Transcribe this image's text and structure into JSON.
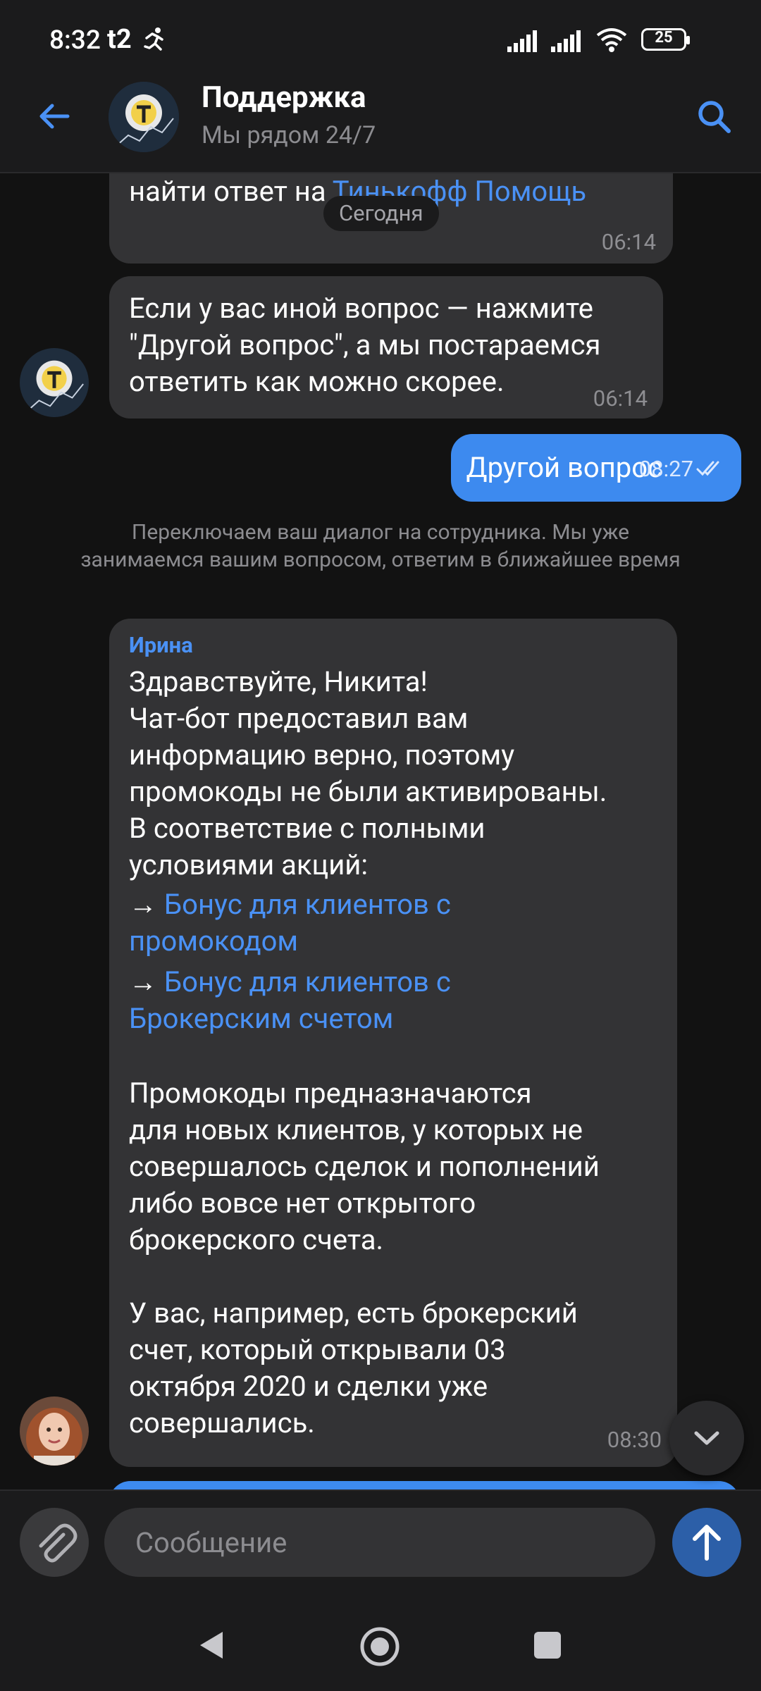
{
  "status_bar": {
    "time": "8:32",
    "carrier": "t2",
    "battery": "25"
  },
  "header": {
    "title": "Поддержка",
    "subtitle": "Мы рядом 24/7"
  },
  "chat": {
    "date_pill": "Сегодня",
    "msg1": {
      "partial_text": "найти ответ на ",
      "link": "Тинькофф Помощь",
      "time": "06:14"
    },
    "msg2": {
      "lines": [
        "Если у вас иной вопрос — нажмите",
        "\"Другой вопрос\", а мы постараемся",
        "ответить как можно скорее."
      ],
      "time": "06:14"
    },
    "outgoing": {
      "text": "Другой вопрос",
      "time": "08:27"
    },
    "system": "Переключаем ваш диалог на сотрудника. Мы уже занимаемся вашим вопросом, ответим в ближайшее время",
    "operator": {
      "author": "Ирина",
      "p1": [
        "Здравствуйте, Никита!",
        "Чат-бот предоставил вам",
        "информацию верно, поэтому",
        "промокоды не были активированы.",
        "В соответствие с полными",
        "условиями акций:"
      ],
      "arrow": "→",
      "link1_lines": [
        "Бонус для клиентов с",
        "промокодом"
      ],
      "link2_lines": [
        "Бонус для клиентов с",
        "Брокерским счетом"
      ],
      "p2": [
        "Промокоды предназначаются",
        "для новых клиентов, у которых не",
        "совершалось сделок и пополнений",
        "либо вовсе нет открытого",
        "брокерского счета."
      ],
      "p3": [
        "У вас, например, есть брокерский",
        "счет, который открывали 03",
        "октября 2020 и сделки уже",
        "совершались."
      ],
      "time": "08:30"
    }
  },
  "composer": {
    "placeholder": "Сообщение"
  },
  "colors": {
    "accent": "#3d8aef",
    "link": "#4a91f5",
    "bubble": "#333335",
    "background": "#121212"
  }
}
